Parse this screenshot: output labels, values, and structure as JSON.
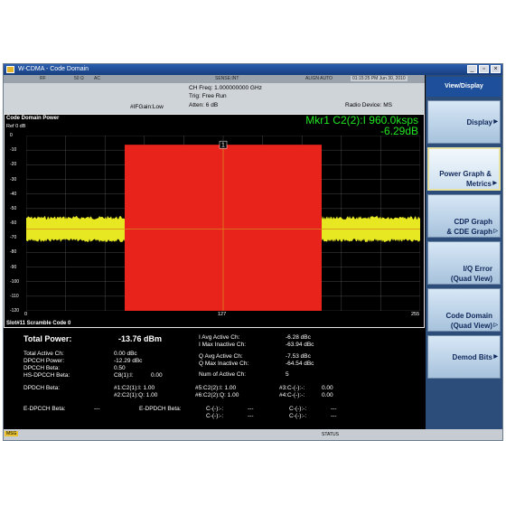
{
  "window": {
    "title": "W-CDMA - Code Domain"
  },
  "statusrow": {
    "rf": "RF",
    "impedance": "50 Ω",
    "coupling": "AC",
    "sense": "SENSE:INT",
    "align": "ALIGN AUTO",
    "time": "01:15:25 PM Jun 30, 2010"
  },
  "settings": {
    "ch_freq": "CH Freq: 1.000000000 GHz",
    "trig": "Trig: Free Run",
    "ifgain": "#IFGain:Low",
    "atten": "Atten: 6 dB",
    "radio_device": "Radio Device: MS"
  },
  "cdp": {
    "title": "Code Domain Power",
    "ref": "Ref  0 dB",
    "marker_label": "Mkr1 C2(2):I 960.0ksps",
    "marker_value": "-6.29dB",
    "marker_number": "1",
    "y_ticks": [
      "0",
      "-10",
      "-20",
      "-30",
      "-40",
      "-50",
      "-60",
      "-70",
      "-80",
      "-90",
      "-100",
      "-110",
      "-120"
    ],
    "x_ticks": [
      "0",
      "127",
      "255"
    ],
    "slot_info": "Slot#11  Scramble Code 0",
    "colors": {
      "trace": "#e8e822",
      "bar": "#e8231c",
      "grid": "#5a5a5a",
      "marker_text": "#22e622"
    }
  },
  "metrics": {
    "total_power_label": "Total Power:",
    "total_power_value": "-13.76 dBm",
    "total_active_ch_label": "Total Active Ch:",
    "total_active_ch_value": "0.00 dBc",
    "dpcch_power_label": "DPCCH Power:",
    "dpcch_power_value": "-12.29 dBc",
    "dpcch_beta_label": "DPCCH Beta:",
    "dpcch_beta_value": "0.50",
    "hs_dpcch_beta_label": "HS-DPCCH Beta:",
    "hs_dpcch_beta_code": "C8(1):I:",
    "hs_dpcch_beta_value": "0.00",
    "dpdch_beta_label": "DPDCH Beta:",
    "dpdch_1": "#1:C2(1):I: 1.00",
    "dpdch_2": "#2:C2(1):Q: 1.00",
    "dpdch_5": "#5:C2(2):I: 1.00",
    "dpdch_6": "#6:C2(2):Q: 1.00",
    "dpdch_3": "#3:C-(-):-:",
    "dpdch_3_value": "0.00",
    "dpdch_4": "#4:C-(-):-:",
    "dpdch_4_value": "0.00",
    "e_dpcch_beta_label": "E-DPCCH Beta:",
    "e_dpcch_beta_value": "---",
    "e_dpdch_beta_label": "E-DPDCH Beta:",
    "e_dpdch_1": "C-(-):-:",
    "e_dpdch_1_value": "---",
    "e_dpdch_2": "C-(-):-:",
    "e_dpdch_2_value": "---",
    "e_dpdch_3": "C-(-):-:",
    "e_dpdch_3_value": "---",
    "e_dpdch_4": "C-(-):-:",
    "e_dpdch_4_value": "---",
    "i_avg_active_label": "I Avg Active Ch:",
    "i_avg_active_value": "-6.28 dBc",
    "i_max_inactive_label": "I Max Inactive Ch:",
    "i_max_inactive_value": "-63.94 dBc",
    "q_avg_active_label": "Q Avg Active Ch:",
    "q_avg_active_value": "-7.53 dBc",
    "q_max_inactive_label": "Q Max Inactive Ch:",
    "q_max_inactive_value": "-64.54 dBc",
    "num_active_label": "Num of Active Ch:",
    "num_active_value": "5"
  },
  "bottombar": {
    "msg": "MSG",
    "status": "STATUS"
  },
  "softkeys": {
    "header": "View/Display",
    "items": [
      {
        "line1": "Display",
        "line2": ""
      },
      {
        "line1": "Power Graph &",
        "line2": "Metrics"
      },
      {
        "line1": "CDP Graph",
        "line2": "& CDE Graph"
      },
      {
        "line1": "I/Q Error",
        "line2": "(Quad View)"
      },
      {
        "line1": "Code Domain",
        "line2": "(Quad View)"
      },
      {
        "line1": "Demod Bits",
        "line2": ""
      }
    ]
  }
}
